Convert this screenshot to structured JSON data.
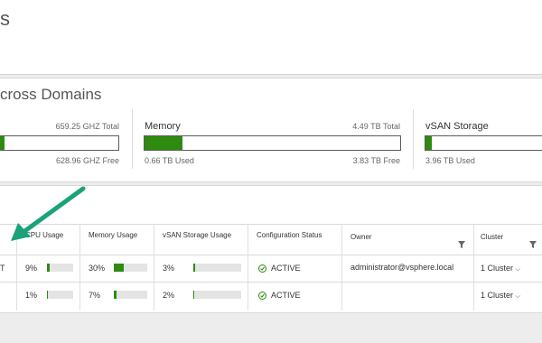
{
  "header": {
    "title": "s"
  },
  "capacity": {
    "title": "cross Domains",
    "cpu": {
      "total": "659.25 GHZ Total",
      "free": "628.96 GHZ Free",
      "used_fraction": 0.046
    },
    "memory": {
      "label": "Memory",
      "total": "4.49 TB Total",
      "used": "0.66 TB Used",
      "free": "3.83 TB Free",
      "used_fraction": 0.147
    },
    "vsan": {
      "label": "vSAN Storage",
      "used": "3.96 TB Used",
      "used_fraction": 0.05
    }
  },
  "table": {
    "columns": {
      "cpu": "CPU Usage",
      "memory": "Memory Usage",
      "vsan": "vSAN Storage Usage",
      "config": "Configuration Status",
      "owner": "Owner",
      "cluster": "Cluster"
    },
    "rows": [
      {
        "type_cut": "T",
        "cpu": "9%",
        "cpu_fraction": 0.09,
        "memory": "30%",
        "memory_fraction": 0.3,
        "vsan": "3%",
        "vsan_fraction": 0.03,
        "status": "ACTIVE",
        "owner": "administrator@vsphere.local",
        "cluster": "1 Cluster"
      },
      {
        "type_cut": "",
        "cpu": "1%",
        "cpu_fraction": 0.01,
        "memory": "7%",
        "memory_fraction": 0.07,
        "vsan": "2%",
        "vsan_fraction": 0.02,
        "status": "ACTIVE",
        "owner": "",
        "cluster": "1 Cluster"
      }
    ]
  },
  "colors": {
    "accent_green": "#2e8b10",
    "arrow_teal": "#1aa37a"
  }
}
